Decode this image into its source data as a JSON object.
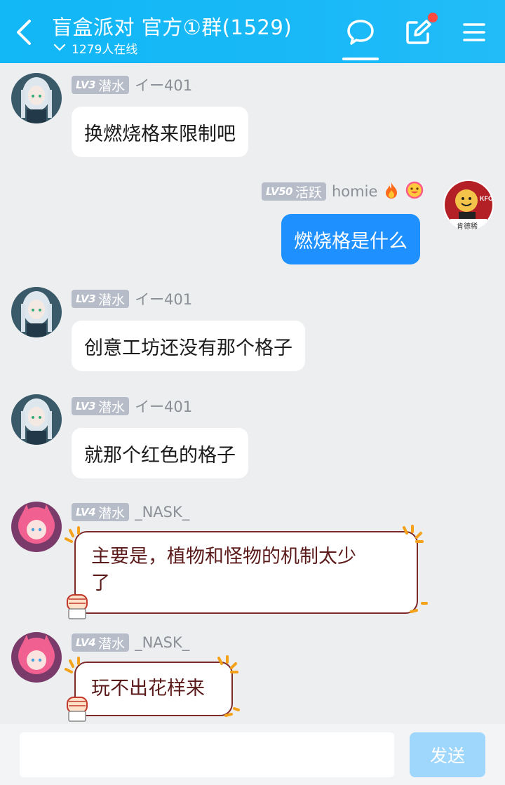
{
  "header": {
    "title": "盲盒派对 官方①群(1529)",
    "online": "1279人在线"
  },
  "messages": [
    {
      "level": "LV3",
      "role": "潜水",
      "nick": "イー401",
      "text": "换燃烧格来限制吧"
    },
    {
      "level": "LV50",
      "role": "活跃",
      "nick": "homie",
      "text": "燃烧格是什么",
      "self": true,
      "avatar_caption": "肯德稀"
    },
    {
      "level": "LV3",
      "role": "潜水",
      "nick": "イー401",
      "text": "创意工坊还没有那个格子"
    },
    {
      "level": "LV3",
      "role": "潜水",
      "nick": "イー401",
      "text": "就那个红色的格子"
    },
    {
      "level": "LV4",
      "role": "潜水",
      "nick": "_NASK_",
      "text_line1": "主要是，植物和怪物的机制太少",
      "text_line2": "了"
    },
    {
      "level": "LV4",
      "role": "潜水",
      "nick": "_NASK_",
      "text": "玩不出花样来"
    }
  ],
  "input": {
    "placeholder": "",
    "send_label": "发送"
  },
  "colors": {
    "header": "#12b7f5",
    "self_bubble": "#1e90ff",
    "badge": "#b6bcc8"
  },
  "icons": [
    "back-arrow-icon",
    "chevron-down-icon",
    "chat-bubble-icon",
    "edit-icon",
    "menu-icon",
    "fire-icon",
    "smile-icon",
    "fist-icon"
  ]
}
